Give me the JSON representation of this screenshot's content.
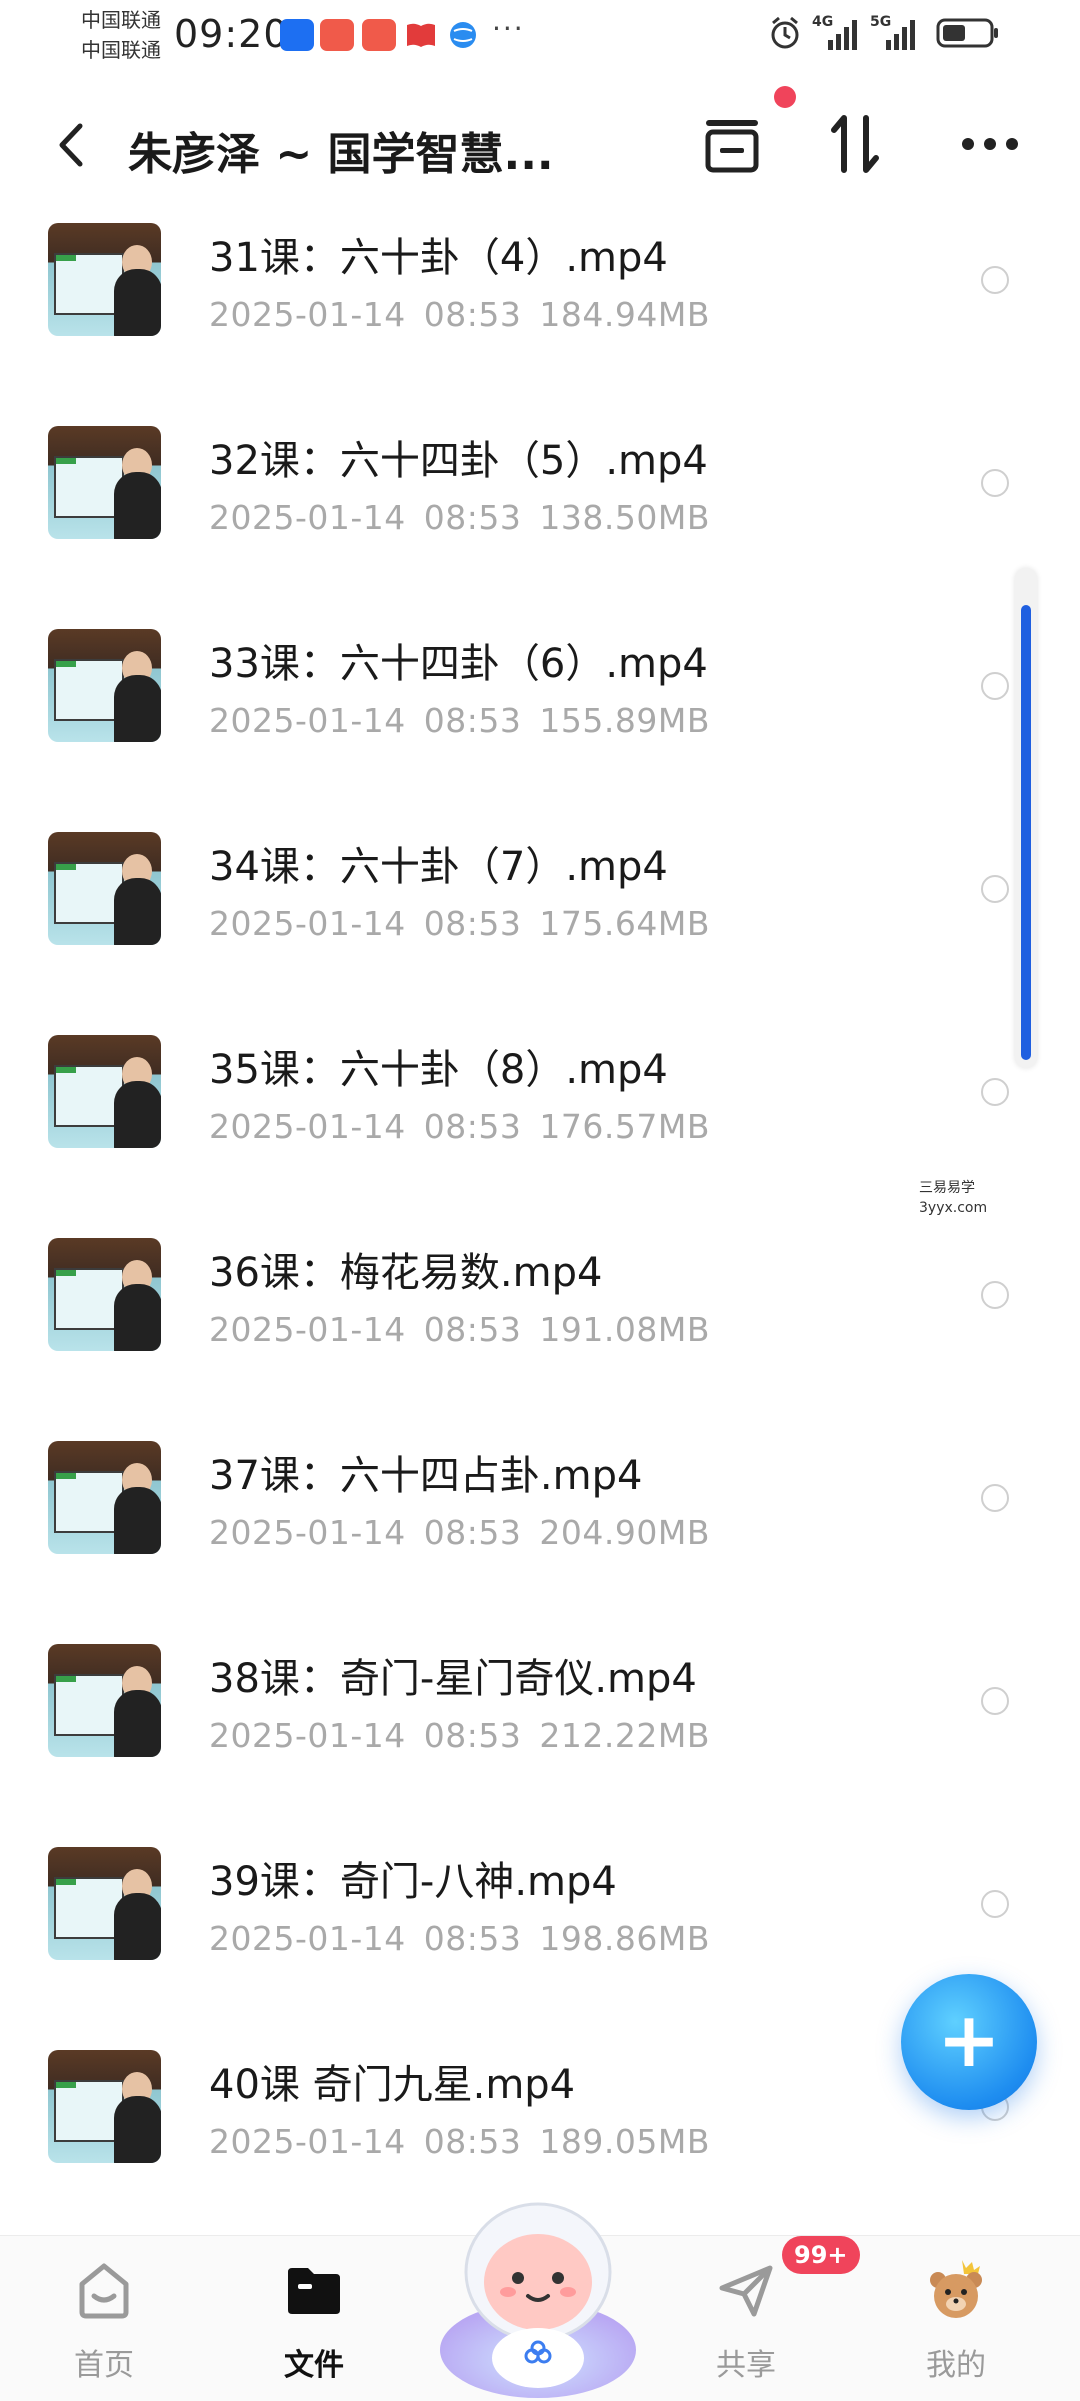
{
  "status_bar": {
    "carrier_1": "中国联通",
    "carrier_2": "中国联通",
    "time": "09:20",
    "more": "···",
    "network_1": "4G",
    "network_2": "5G"
  },
  "header": {
    "title": "朱彦泽 ~ 国学智慧..."
  },
  "files": [
    {
      "name": "31课：六十卦（4）.mp4",
      "date": "2025-01-14",
      "time": "08:53",
      "size": "184.94MB"
    },
    {
      "name": "32课：六十四卦（5）.mp4",
      "date": "2025-01-14",
      "time": "08:53",
      "size": "138.50MB"
    },
    {
      "name": "33课：六十四卦（6）.mp4",
      "date": "2025-01-14",
      "time": "08:53",
      "size": "155.89MB"
    },
    {
      "name": "34课：六十卦（7）.mp4",
      "date": "2025-01-14",
      "time": "08:53",
      "size": "175.64MB"
    },
    {
      "name": "35课：六十卦（8）.mp4",
      "date": "2025-01-14",
      "time": "08:53",
      "size": "176.57MB"
    },
    {
      "name": "36课：梅花易数.mp4",
      "date": "2025-01-14",
      "time": "08:53",
      "size": "191.08MB"
    },
    {
      "name": "37课：六十四占卦.mp4",
      "date": "2025-01-14",
      "time": "08:53",
      "size": "204.90MB"
    },
    {
      "name": "38课：奇门-星门奇仪.mp4",
      "date": "2025-01-14",
      "time": "08:53",
      "size": "212.22MB"
    },
    {
      "name": "39课：奇门-八神.mp4",
      "date": "2025-01-14",
      "time": "08:53",
      "size": "198.86MB"
    },
    {
      "name": "40课 奇门九星.mp4",
      "date": "2025-01-14",
      "time": "08:53",
      "size": "189.05MB"
    }
  ],
  "watermark": {
    "line1": "三易易学",
    "line2": "3yyx.com"
  },
  "fab": {
    "label": "+"
  },
  "nav": {
    "home": "首页",
    "files": "文件",
    "share": "共享",
    "mine": "我的",
    "share_badge": "99+"
  },
  "colors": {
    "accent": "#1f5fe0",
    "fab": "#1e8df0",
    "badge": "#f0445b",
    "meta_text": "#a9a9a9"
  }
}
